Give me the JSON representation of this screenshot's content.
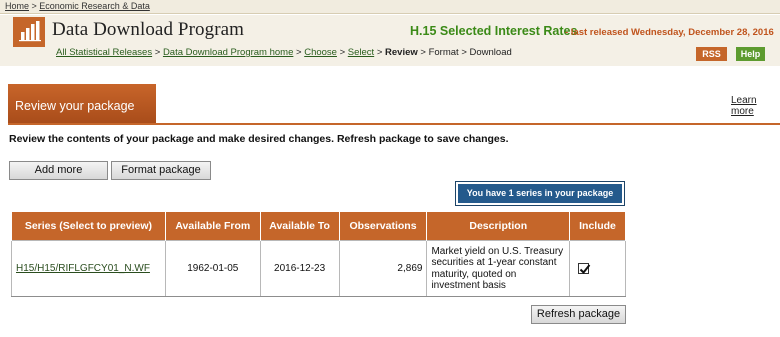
{
  "top_breadcrumb": {
    "home": "Home",
    "sep": " > ",
    "section": "Economic Research & Data"
  },
  "header": {
    "app_title": "Data Download Program",
    "release_title": "H.15 Selected Interest Rates",
    "release_date": " - last released Wednesday, December 28, 2016",
    "logo_icon": "bar-chart-icon"
  },
  "nav_breadcrumb": {
    "items": [
      {
        "label": "All Statistical Releases",
        "link": true
      },
      {
        "label": "Data Download Program home",
        "link": true
      },
      {
        "label": "Choose",
        "link": true
      },
      {
        "label": "Select",
        "link": true
      },
      {
        "label": "Review",
        "link": false,
        "current": true
      },
      {
        "label": "Format",
        "link": false
      },
      {
        "label": "Download",
        "link": false
      }
    ]
  },
  "buttons": {
    "rss": "RSS",
    "help": "Help",
    "add_more": "Add more",
    "format_package": "Format package",
    "refresh_package": "Refresh package"
  },
  "section": {
    "title": "Review your package",
    "learn_more": "Learn more"
  },
  "instructions": "Review the contents of your package and make desired changes.  Refresh package to save changes.",
  "series_badge": "You have 1 series in your package",
  "table": {
    "headers": [
      "Series (Select to preview)",
      "Available From",
      "Available To",
      "Observations",
      "Description",
      "Include"
    ],
    "rows": [
      {
        "series": "H15/H15/RIFLGFCY01_N.WF",
        "from": "1962-01-05",
        "to": "2016-12-23",
        "observations": "2,869",
        "description": "Market yield on U.S. Treasury securities at 1-year constant maturity, quoted on investment basis",
        "include": true
      }
    ]
  },
  "colors": {
    "accent": "#c5662a",
    "green": "#3b8a17",
    "badge": "#245a8c"
  }
}
